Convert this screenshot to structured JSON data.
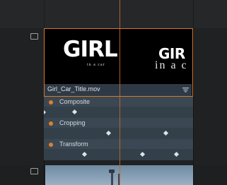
{
  "clip": {
    "name": "Girl_Car_Title.mov",
    "thumb_a": {
      "title": "GIRL",
      "subtitle": "in a car"
    },
    "thumb_b": {
      "title": "GIR",
      "subtitle": "in a c"
    }
  },
  "effects": [
    {
      "label": "Composite"
    },
    {
      "label": "Cropping"
    },
    {
      "label": "Transform"
    }
  ],
  "colors": {
    "selection_border": "#d47a2c",
    "effect_dot": "#e07f2a",
    "playhead": "#c06a2a",
    "effect_lane": "#3b4853"
  },
  "icons": {
    "track_icon": "monitor-icon",
    "clip_menu": "menu-lines-icon",
    "keyframe": "diamond-keyframe-icon"
  }
}
